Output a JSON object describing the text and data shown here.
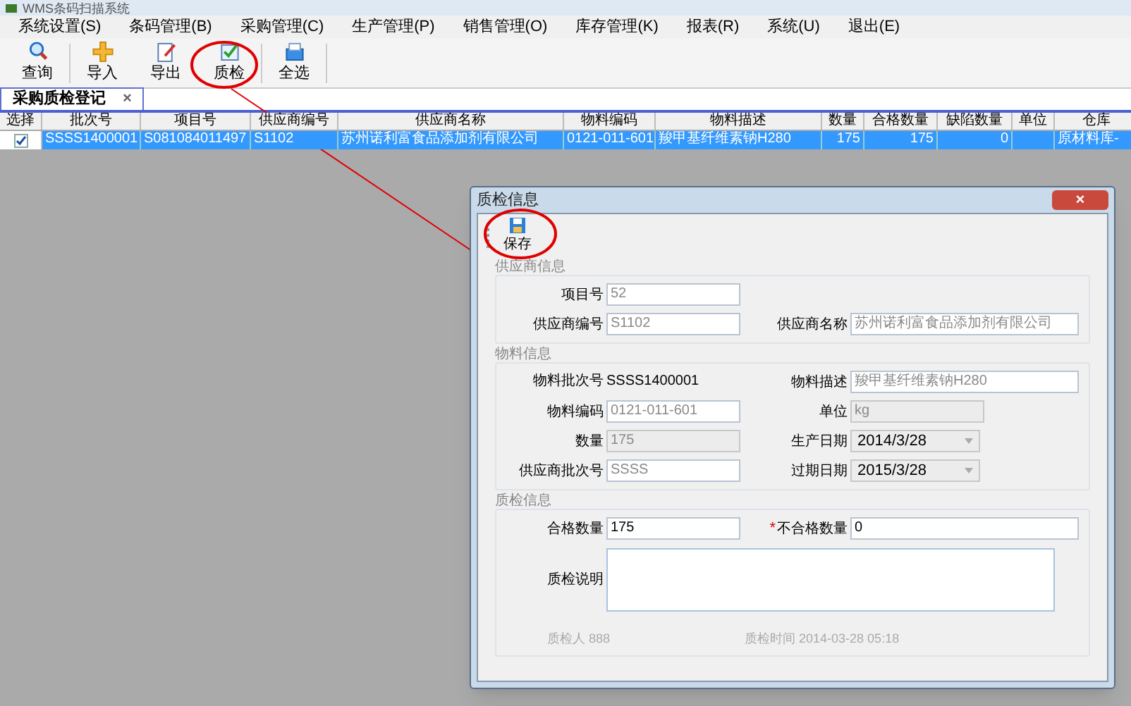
{
  "window": {
    "title": "WMS条码扫描系统"
  },
  "menu": [
    "系统设置(S)",
    "条码管理(B)",
    "采购管理(C)",
    "生产管理(P)",
    "销售管理(O)",
    "库存管理(K)",
    "报表(R)",
    "系统(U)",
    "退出(E)"
  ],
  "toolbar": [
    {
      "label": "查询",
      "kind": "search"
    },
    {
      "label": "导入",
      "kind": "import"
    },
    {
      "label": "导出",
      "kind": "export"
    },
    {
      "label": "质检",
      "kind": "check"
    },
    {
      "label": "全选",
      "kind": "selectall"
    }
  ],
  "tabs": [
    {
      "label": "采购质检登记",
      "close": "×",
      "selected": true
    }
  ],
  "table": {
    "columns": [
      "选择",
      "批次号",
      "项目号",
      "供应商编号",
      "供应商名称",
      "物料编码",
      "物料描述",
      "数量",
      "合格数量",
      "缺陷数量",
      "单位",
      "仓库"
    ],
    "rows": [
      {
        "checked": true,
        "selected": true,
        "cells": [
          "",
          "SSSS1400001",
          "S081084011497",
          "S1102",
          "苏州诺利富食品添加剂有限公司",
          "0121-011-601",
          "羧甲基纤维素钠H280",
          "175",
          "175",
          "0",
          "",
          "原材料库-"
        ]
      }
    ]
  },
  "dialog": {
    "title": "质检信息",
    "close": "×",
    "save": "保存",
    "groups": [
      {
        "title": "供应商信息",
        "rows": [
          [
            {
              "label": "项目号",
              "value": "52",
              "kind": "input",
              "editable": false,
              "disabled": false
            }
          ],
          [
            {
              "label": "供应商编号",
              "value": "S1102",
              "kind": "input",
              "editable": false,
              "disabled": false
            },
            {
              "label": "供应商名称",
              "value": "苏州诺利富食品添加剂有限公司",
              "kind": "input",
              "editable": false,
              "disabled": false
            }
          ]
        ]
      },
      {
        "title": "物料信息",
        "rows": [
          [
            {
              "label": "物料批次号",
              "value": "SSSS1400001",
              "kind": "static",
              "editable": true,
              "disabled": false
            },
            {
              "label": "物料描述",
              "value": "羧甲基纤维素钠H280",
              "kind": "input",
              "editable": false,
              "disabled": false
            }
          ],
          [
            {
              "label": "物料编码",
              "value": "0121-011-601",
              "kind": "input",
              "editable": false,
              "disabled": false
            },
            {
              "label": "单位",
              "value": "kg",
              "kind": "input",
              "editable": false,
              "disabled": true
            }
          ],
          [
            {
              "label": "数量",
              "value": "175",
              "kind": "input",
              "editable": false,
              "disabled": true
            },
            {
              "label": "生产日期",
              "value": "2014/3/28",
              "kind": "date",
              "editable": true,
              "disabled": true
            }
          ],
          [
            {
              "label": "供应商批次号",
              "value": "SSSS",
              "kind": "input",
              "editable": false,
              "disabled": false
            },
            {
              "label": "过期日期",
              "value": "2015/3/28",
              "kind": "date",
              "editable": true,
              "disabled": true
            }
          ]
        ]
      },
      {
        "title": "质检信息",
        "rows": [
          [
            {
              "label": "合格数量",
              "value": "175",
              "kind": "input",
              "editable": true,
              "disabled": false
            },
            {
              "label": "不合格数量",
              "value": "0",
              "kind": "input",
              "editable": true,
              "disabled": false,
              "required_mark": "*"
            }
          ],
          [
            {
              "label": "质检说明",
              "kind": "textarea",
              "disabled": false
            }
          ]
        ],
        "footer": [
          {
            "label": "质检人",
            "value": "888"
          },
          {
            "label": "质检时间",
            "value": "2014-03-28 05:18"
          }
        ]
      }
    ]
  }
}
